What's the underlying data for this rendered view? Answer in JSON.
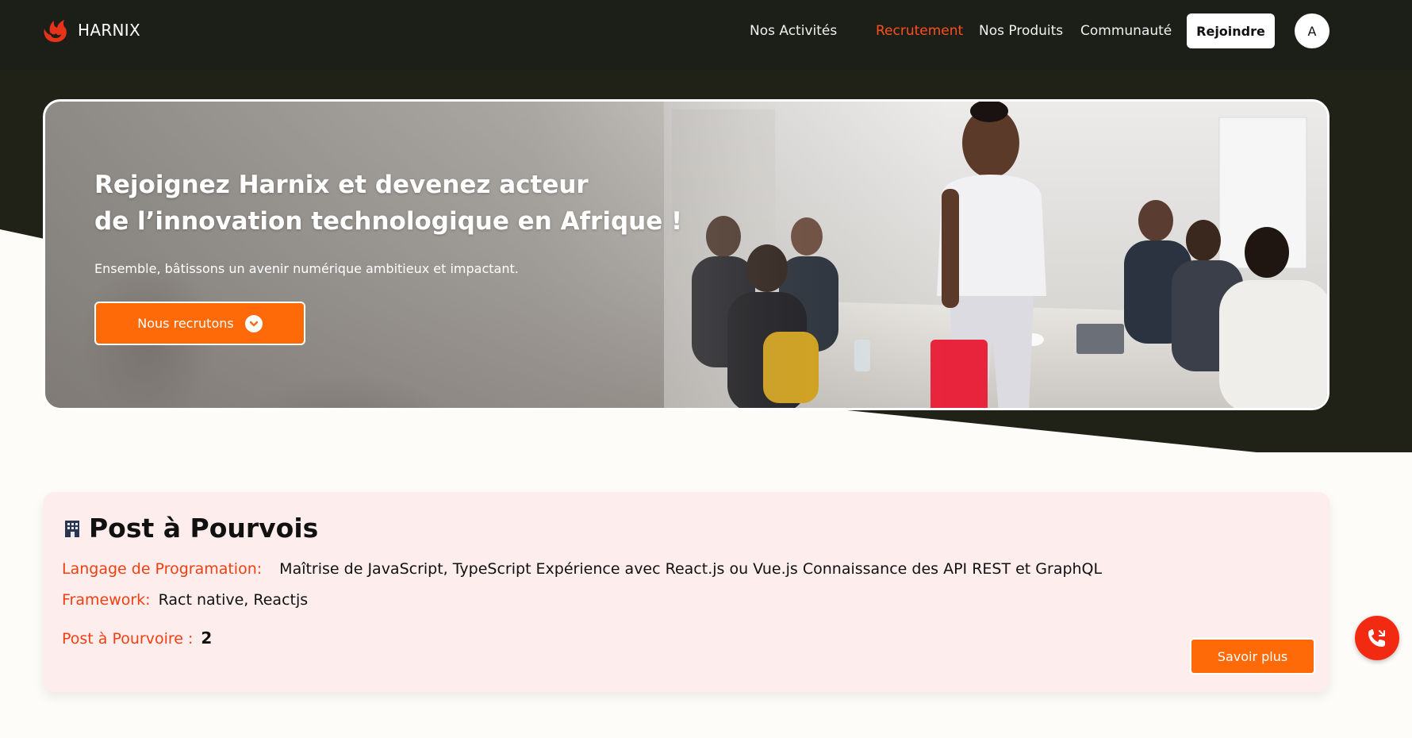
{
  "brand": {
    "name": "HARNIX",
    "logo_icon": "phoenix-logo-icon",
    "accent": "#ff4f1f"
  },
  "nav": {
    "items": [
      {
        "label": "Nos Activités",
        "active": false
      },
      {
        "label": "Recrutement",
        "active": true
      },
      {
        "label": "Nos Produits",
        "active": false
      },
      {
        "label": "Communauté",
        "active": false
      }
    ],
    "join_label": "Rejoindre",
    "avatar_initial": "A"
  },
  "hero": {
    "title_line1": "Rejoignez Harnix et devenez acteur",
    "title_line2": "de l’innovation technologique en Afrique !",
    "subtitle": "Ensemble, bâtissons un avenir numérique ambitieux et impactant.",
    "cta_label": "Nous recrutons",
    "cta_icon": "chevron-down-icon"
  },
  "job": {
    "title": "Post à Pourvois",
    "title_icon": "office-building-icon",
    "language_label": "Langage de Programation:",
    "language_value": "Maîtrise de JavaScript, TypeScript Expérience avec React.js ou Vue.js Connaissance des API REST et GraphQL",
    "framework_label": "Framework:",
    "framework_value": "Ract native, Reactjs",
    "openings_label": "Post à Pourvoire :",
    "openings_count": "2",
    "more_label": "Savoir plus"
  },
  "colors": {
    "dark": "#1c1e18",
    "orange": "#ff6a08",
    "card_bg": "#fdeded",
    "call": "#f22a12"
  },
  "call_button": {
    "icon": "phone-icon"
  }
}
